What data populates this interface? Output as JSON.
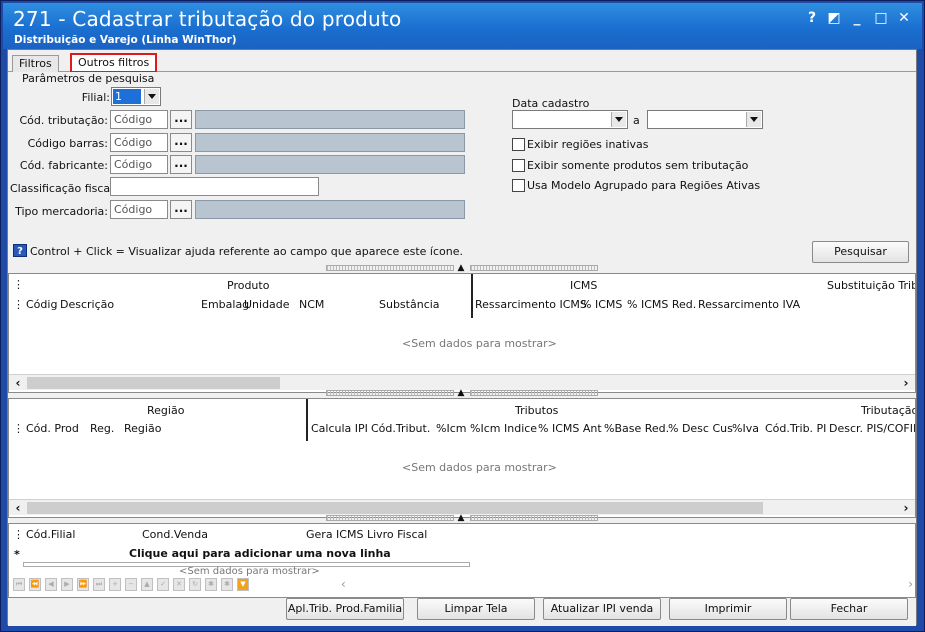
{
  "window": {
    "title": "271 - Cadastrar tributação do produto",
    "subtitle": "Distribuição e Varejo (Linha WinThor)",
    "controls": [
      "?",
      "◩",
      "_",
      "□",
      "✕"
    ]
  },
  "tabs": [
    "Filtros",
    "Outros filtros"
  ],
  "filters": {
    "group_title": "Parâmetros de pesquisa",
    "filial_label": "Filial:",
    "filial_value": "1",
    "cod_tributacao_label": "Cód. tributação:",
    "codigo_barras_label": "Código barras:",
    "cod_fabricante_label": "Cód. fabricante:",
    "classificacao_fiscal_label": "Classificação fiscal:",
    "tipo_mercadoria_label": "Tipo mercadoria:",
    "codigo_placeholder": "Código",
    "dots": "...",
    "data_cadastro_label": "Data cadastro",
    "a_label": "a",
    "chk_regioes_inativas": "Exibir regiões inativas",
    "chk_sem_tributacao": "Exibir somente produtos sem tributação",
    "chk_modelo_agrupado": "Usa Modelo Agrupado para Regiões Ativas"
  },
  "hint": "Control + Click = Visualizar ajuda referente ao campo que aparece este ícone.",
  "pesquisar_label": "Pesquisar",
  "grid1": {
    "bands": [
      "Produto",
      "ICMS",
      "Substituição Tribu"
    ],
    "columns": [
      "Códig",
      "Descrição",
      "Embalag",
      "Unidade",
      "NCM",
      "Substância",
      "Ressarcimento ICMS",
      "% ICMS",
      "% ICMS Red.",
      "Ressarcimento IVA"
    ],
    "empty": "<Sem dados para mostrar>"
  },
  "grid2": {
    "bands": [
      "Região",
      "Tributos",
      "Tributação"
    ],
    "columns": [
      "Cód. Prod",
      "Reg.",
      "Região",
      "Calcula IPI?",
      "Cód.Tribut.",
      "%Icm",
      "%Icm",
      "Indice",
      "% ICMS Ant",
      "%Base Red.",
      "% Desc Cus",
      "%Iva",
      "Cód.Trib. PI",
      "Descr. PIS/COFIN"
    ],
    "empty": "<Sem dados para mostrar>"
  },
  "grid3": {
    "columns": [
      "Cód.Filial",
      "Cond.Venda",
      "Gera ICMS Livro Fiscal"
    ],
    "new_row": "Clique aqui para adicionar uma nova linha",
    "new_row_marker": "*",
    "empty": "<Sem dados para mostrar>"
  },
  "buttons": {
    "apl_trib": "Apl.Trib. Prod.Familia",
    "limpar": "Limpar Tela",
    "atualizar_ipi": "Atualizar IPI venda",
    "imprimir": "Imprimir",
    "fechar": "Fechar"
  },
  "colors": {
    "title_bar": "#1a6fd0",
    "highlight": "#e0191b",
    "frame": "#1f4aa8"
  }
}
